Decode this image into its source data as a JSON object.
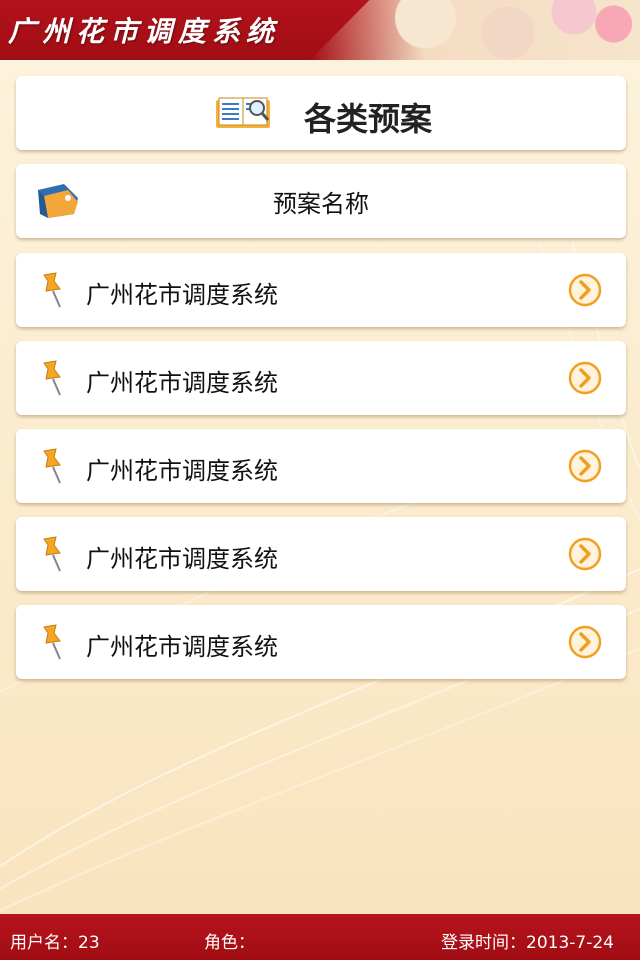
{
  "header": {
    "title": "广州花市调度系统"
  },
  "title_card": {
    "label": "各类预案",
    "icon": "book-magnifier-icon"
  },
  "name_card": {
    "label": "预案名称",
    "icon": "tag-icon"
  },
  "rows": [
    {
      "label": "广州花市调度系统"
    },
    {
      "label": "广州花市调度系统"
    },
    {
      "label": "广州花市调度系统"
    },
    {
      "label": "广州花市调度系统"
    },
    {
      "label": "广州花市调度系统"
    }
  ],
  "footer": {
    "user": "用户名：23",
    "role": "角色：",
    "login_time": "登录时间：2013-7-24"
  },
  "colors": {
    "header_red": "#b3121b",
    "arrow_orange": "#f0a020",
    "background": "#fdf3dd"
  }
}
